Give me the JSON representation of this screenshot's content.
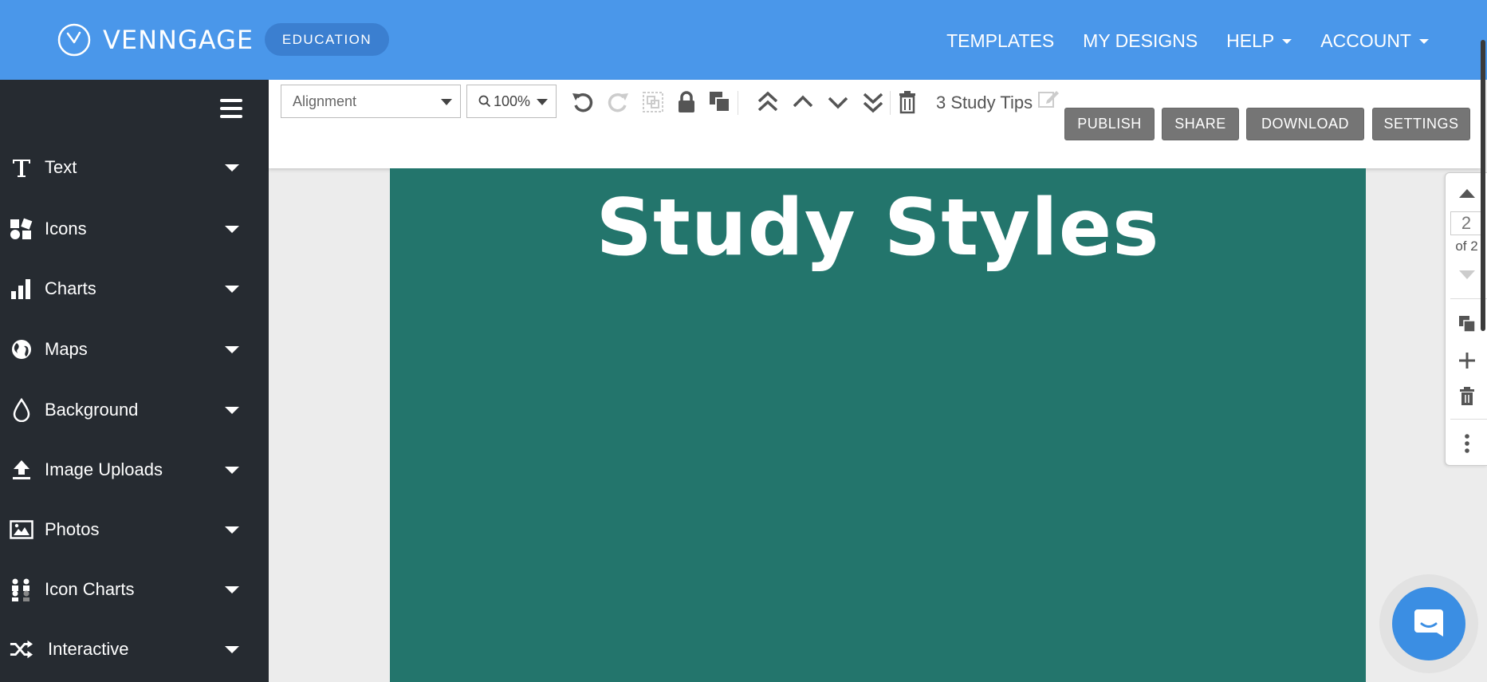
{
  "header": {
    "brand": "VENNGAGE",
    "badge": "EDUCATION",
    "nav": {
      "templates": "TEMPLATES",
      "my_designs": "MY DESIGNS",
      "help": "HELP",
      "account": "ACCOUNT"
    }
  },
  "sidebar": {
    "items": [
      {
        "label": "Text",
        "icon": "text-icon"
      },
      {
        "label": "Icons",
        "icon": "shapes-icon"
      },
      {
        "label": "Charts",
        "icon": "bar-chart-icon"
      },
      {
        "label": "Maps",
        "icon": "globe-icon"
      },
      {
        "label": "Background",
        "icon": "droplet-icon"
      },
      {
        "label": "Image Uploads",
        "icon": "upload-icon"
      },
      {
        "label": "Photos",
        "icon": "image-icon"
      },
      {
        "label": "Icon Charts",
        "icon": "people-icon"
      },
      {
        "label": "Interactive",
        "icon": "shuffle-icon"
      }
    ]
  },
  "toolbar": {
    "alignment": "Alignment",
    "zoom": "100%",
    "doc_title": "3 Study Tips",
    "publish": "PUBLISH",
    "share": "SHARE",
    "download": "DOWNLOAD",
    "settings": "SETTINGS"
  },
  "canvas": {
    "title": "Study Styles",
    "background_color": "#23756c"
  },
  "pages": {
    "current": "2",
    "of_label": "of 2"
  },
  "colors": {
    "header": "#4a97ea",
    "sidebar": "#262b31",
    "button": "#757575",
    "chat": "#3b8ee3"
  }
}
